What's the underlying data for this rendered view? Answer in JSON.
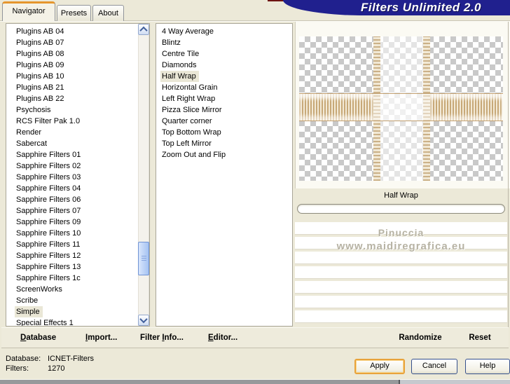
{
  "window": {
    "banner_title": "Filters Unlimited 2.0"
  },
  "tabs": [
    {
      "label": "Navigator",
      "active": true
    },
    {
      "label": "Presets",
      "active": false
    },
    {
      "label": "About",
      "active": false
    }
  ],
  "category_list": {
    "items": [
      {
        "label": "Plugins AB 04"
      },
      {
        "label": "Plugins AB 07"
      },
      {
        "label": "Plugins AB 08"
      },
      {
        "label": "Plugins AB 09"
      },
      {
        "label": "Plugins AB 10"
      },
      {
        "label": "Plugins AB 21"
      },
      {
        "label": "Plugins AB 22"
      },
      {
        "label": "Psychosis"
      },
      {
        "label": "RCS Filter Pak 1.0"
      },
      {
        "label": "Render"
      },
      {
        "label": "Sabercat"
      },
      {
        "label": "Sapphire Filters 01"
      },
      {
        "label": "Sapphire Filters 02"
      },
      {
        "label": "Sapphire Filters 03"
      },
      {
        "label": "Sapphire Filters 04"
      },
      {
        "label": "Sapphire Filters 06"
      },
      {
        "label": "Sapphire Filters 07"
      },
      {
        "label": "Sapphire Filters 09"
      },
      {
        "label": "Sapphire Filters 10"
      },
      {
        "label": "Sapphire Filters 11"
      },
      {
        "label": "Sapphire Filters 12"
      },
      {
        "label": "Sapphire Filters 13"
      },
      {
        "label": "Sapphire Filters 1c"
      },
      {
        "label": "ScreenWorks"
      },
      {
        "label": "Scribe"
      },
      {
        "label": "Simple",
        "selected": true
      },
      {
        "label": "Special Effects 1"
      }
    ]
  },
  "filter_list": {
    "items": [
      {
        "label": "4 Way Average"
      },
      {
        "label": "Blintz"
      },
      {
        "label": "Centre Tile"
      },
      {
        "label": "Diamonds"
      },
      {
        "label": "Half Wrap",
        "selected": true
      },
      {
        "label": "Horizontal Grain"
      },
      {
        "label": "Left Right Wrap"
      },
      {
        "label": "Pizza Slice Mirror"
      },
      {
        "label": "Quarter corner"
      },
      {
        "label": "Top Bottom Wrap"
      },
      {
        "label": "Top Left Mirror"
      },
      {
        "label": "Zoom Out and Flip"
      }
    ]
  },
  "preview": {
    "selected_filter_label": "Half Wrap",
    "watermark_line1": "Pinuccia",
    "watermark_line2": "www.maidiregrafica.eu"
  },
  "command_bar": {
    "database": "&Database",
    "import": "&Import...",
    "filter_info": "Filter &Info...",
    "editor": "&Editor...",
    "randomize": "Randomize",
    "reset": "Reset"
  },
  "status": {
    "database_label": "Database:",
    "database_value": "ICNET-Filters",
    "filters_label": "Filters:",
    "filters_value": "1270"
  },
  "dialog_buttons": {
    "apply": "Apply",
    "cancel": "Cancel",
    "help": "Help"
  },
  "icons": {
    "scroll_up": "chevron-up",
    "scroll_down": "chevron-down"
  },
  "colors": {
    "xp_beige": "#ECE9D8",
    "banner_navy": "#20208E",
    "banner_maroon": "#6E1311",
    "tab_accent_orange": "#E5962D",
    "selection_beige": "#EAE7D6",
    "checker_gray": "#C9C9C9",
    "lace_tan": "#C7A877",
    "watermark_gray": "#B7B3A4",
    "focus_orange": "#E8A33C"
  }
}
